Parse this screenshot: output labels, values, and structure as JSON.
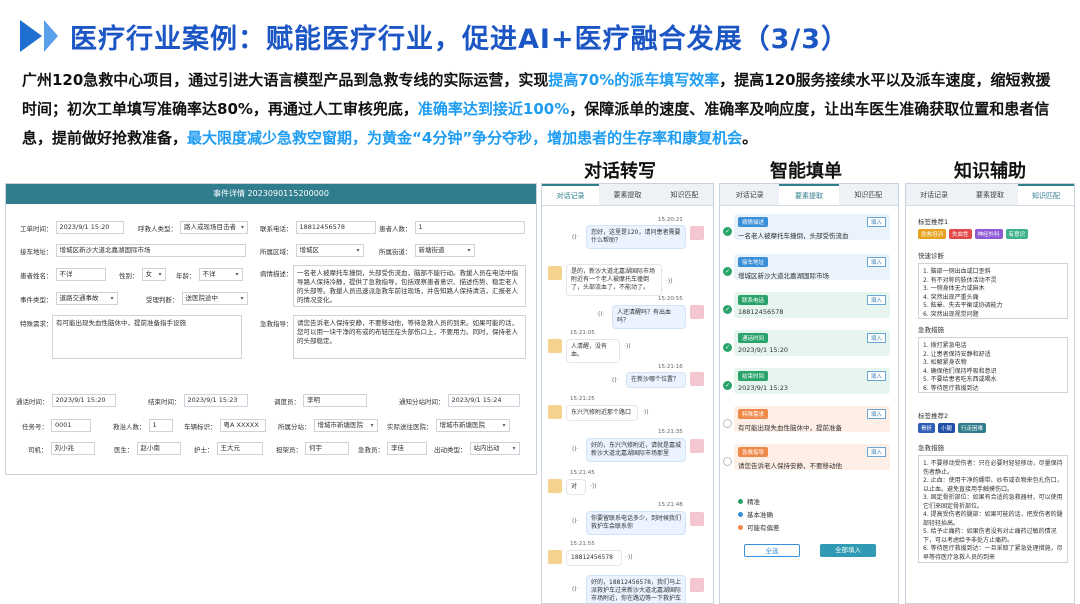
{
  "header": {
    "title": "医疗行业案例：赋能医疗行业，促进AI+医疗融合发展（3/3）",
    "desc_1": "广州120急救中心项目，通过引进大语言模型产品到急救专线的实际运营，实现",
    "desc_hl_1": "提高70%的派车填写效率",
    "desc_2": "，提高120服务接续水平以及派车速度，缩短救援时间；初次工单填写准确率达80%，再通过人工审核兜底，",
    "desc_hl_2": "准确率达到接近100%",
    "desc_3": "，保障派单的速度、准确率及响应度，让出车医生准确获取位置和患者信息，提前做好抢救准备，",
    "desc_hl_3": "最大限度减少急救空窗期，为黄金“4分钟”争分夺秒，增加患者的生存率和康复机会",
    "desc_4": "。"
  },
  "sections": {
    "chat": "对话转写",
    "fill": "智能填单",
    "know": "知识辅助"
  },
  "form": {
    "head": "事件详情 2023090115200000",
    "work_time_l": "工单时间：",
    "work_time": "2023/9/1 15:20",
    "caller_type_l": "呼救人类型：",
    "caller_type": "路人或现场目击者",
    "phone_l": "联系电话：",
    "phone": "18812456578",
    "patients_l": "患者人数：",
    "patients": "1",
    "addr_l": "接车地址：",
    "addr": "增城区新沙大道北嘉湖国际市场",
    "area_l": "所属区域：",
    "area": "增城区",
    "street_l": "所属街道：",
    "street": "新塘街道",
    "name_l": "患者姓名：",
    "name": "不详",
    "sex_l": "性别：",
    "sex": "女",
    "age_l": "年龄：",
    "age": "不详",
    "cond_l": "病情描述：",
    "cond": "一名老人被摩托车撞倒，头部受伤流血，脑部不能行动。救援人员在电话中指导路人保持冷静，提供了急救指导，包括观察患者意识、描述伤势、稳定老人的头部等。救援人员迅速派急救车前往现场，并告知路人保持清洁，汇报老人的情况变化。",
    "event_l": "事件类型：",
    "event": "道路交通事故",
    "accept_l": "受理判断：",
    "accept": "送医院途中",
    "special_l": "特殊需求：",
    "special": "有可能出现失血性脑休中，提前准备指手设施",
    "guide_l": "急救指导：",
    "guide": "请您告诉老人保持安静，不要移动他，等待急救人员的到来。如果可能的话，您可以用一块干净的布或的布轻压在头部伤口上，不要用力。同时，保持老人的头部稳定。",
    "notify_l": "通话时间：",
    "notify": "2023/9/1 15:20",
    "end_l": "结束时间：",
    "end": "2023/9/1 15:23",
    "dispatcher_l": "调度员：",
    "dispatcher": "李明",
    "report_l": "通知分站时间：",
    "report": "2023/9/1 15:24",
    "task_l": "任务号：",
    "task": "0001",
    "rescue_l": "救治人数：",
    "rescue": "1",
    "plate_l": "车辆标识：",
    "plate": "粤A XXXXX",
    "branch_l": "所属分站：",
    "branch": "增城市新塘医院",
    "hospital_l": "实际送往医院：",
    "hospital": "增城市新塘医院",
    "driver_l": "司机：",
    "driver": "刘小兆",
    "doctor_l": "医生：",
    "doctor": "赵小南",
    "nurse_l": "护士：",
    "nurse": "王大元",
    "stretcher_l": "担架员：",
    "stretcher": "何宇",
    "attendant_l": "急救员：",
    "attendant": "李佳",
    "status_l": "出动类型：",
    "status": "站内出动"
  },
  "tabs": [
    "对话记录",
    "要素提取",
    "知识匹配"
  ],
  "chat": {
    "t1": "15:20:21",
    "m1": "您好，这里是120，请问患者需要什么帮助？",
    "m2": "是的，新沙大道北嘉湖国际市场附近有一个老人被摩托车撞倒了，头部流血了，不能动了。",
    "t3": "15:20:55",
    "m3": "人还清醒吗？有出血吗？",
    "t4": "15:21:05",
    "m4": "人清醒，没有血。",
    "t5": "15:21:16",
    "m5": "在新沙哪个位置？",
    "t6": "15:21:25",
    "m6": "东兴汽修附近那个路口",
    "t7": "15:21:35",
    "m7": "好的，东兴汽修附近，请就是嘉城新沙大道北嘉湖国际市场那里",
    "t8": "15:21:45",
    "m8": "对",
    "t9": "15:21:48",
    "m9": "你要留联系电话多少，到时候我们救护车会联系你",
    "t10": "15:21:55",
    "m10": "18812456578",
    "m11": "好的，18812456578，我们马上派救护车过来新沙大道北嘉湖国际市场附近，你在路边等一下救护车"
  },
  "fill": {
    "insert": "填入",
    "c1_tag": "病情描述",
    "c1": "一名老人被摩托车撞倒，头部受伤流血",
    "c2_tag": "接车地址",
    "c2": "增城区新沙大道北嘉湖国际市场",
    "c3_tag": "联系电话",
    "c3": "18812456578",
    "c4_tag": "通话时间",
    "c4": "2023/9/1 15:20",
    "c5_tag": "结束时间",
    "c5": "2023/9/1 15:23",
    "c6_tag": "特殊需求",
    "c6": "有可能出现失血性脑休中，提前准备",
    "c7_tag": "急救指导",
    "c7": "请您告诉老人保持安静，不要移动他",
    "legend": [
      "精准",
      "基本准确",
      "可能有偏差"
    ],
    "select_all": "全选",
    "fill_all": "全部填入"
  },
  "know": {
    "l1": "标签推荐1",
    "tags1": [
      "急救培训",
      "失血性",
      "神经外科",
      "有意识"
    ],
    "l2": "快速诊断",
    "d1": [
      "1. 脑部一侧出血或口歪斜",
      "2. 有不对称的肢体活动不灵",
      "3. 一侧身体无力或麻木",
      "4. 突然出现严重头痛",
      "5. 眩晕、失去平衡或协调能力",
      "6. 突然出现视觉问题"
    ],
    "l3": "急救措施",
    "d2": [
      "1. 拨打紧急电话",
      "2. 让患者保持安静和舒适",
      "3. 松解紧身衣物",
      "4. 确保他们保持呼吸和意识",
      "5. 不要给患者吃东西或喝水",
      "6. 等待医疗救援到达"
    ],
    "l4": "标签推荐2",
    "tags2": [
      "骨折",
      "小腿",
      "行走困难"
    ],
    "l5": "急救措施",
    "d3": [
      "1. 不要移动受伤者：只在必要时轻轻移动，尽量保持伤者静止。",
      "2. 止血：使用干净的绷带、纱布或衣物来包扎伤口，以止血。避免直接用手触摸伤口。",
      "3. 固定骨折部位：如果有合适的急救器材，可以使用它们来固定骨折部位。",
      "4. 提高受伤者的腿部：如果可能的话，把受伤者的腿部轻轻抬高。",
      "5. 给予止痛药：如果伤者没有对止痛药过敏的情况下，可以考虑给予非处方止痛药。",
      "6. 等待医疗救援到达：一旦采取了紧急处理措施，尽早等待医疗急救人员的到来"
    ]
  },
  "colors": {
    "accent": "#1e9cf2",
    "title": "#1b56c4",
    "header_bar": "#2f7d8d"
  }
}
